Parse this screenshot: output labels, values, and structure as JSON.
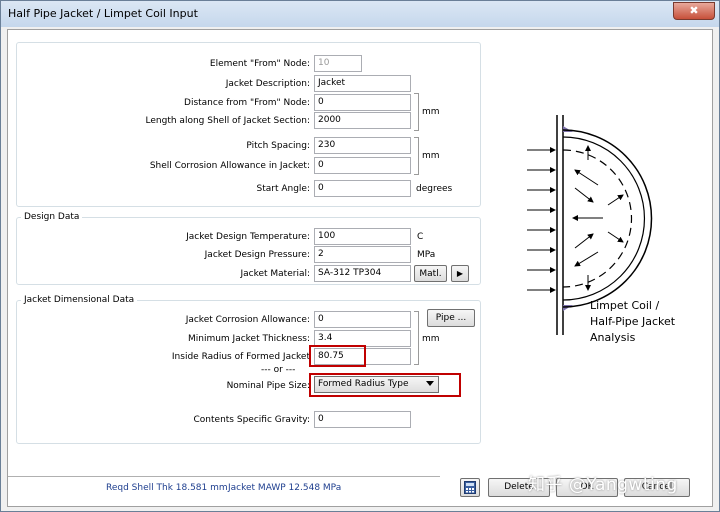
{
  "window": {
    "title": "Half Pipe Jacket / Limpet Coil Input",
    "close_glyph": "✖"
  },
  "top_group": {
    "fields": [
      {
        "label": "Element \"From\" Node:",
        "value": "10"
      },
      {
        "label": "Jacket Description:",
        "value": "Jacket"
      },
      {
        "label": "Distance from \"From\" Node:",
        "value": "0"
      },
      {
        "label": "Length along Shell of Jacket Section:",
        "value": "2000"
      },
      {
        "label": "Pitch Spacing:",
        "value": "230"
      },
      {
        "label": "Shell Corrosion Allowance in Jacket:",
        "value": "0"
      },
      {
        "label": "Start Angle:",
        "value": "0"
      }
    ],
    "unit_mm_1": "mm",
    "unit_mm_2": "mm",
    "unit_degrees": "degrees"
  },
  "design_group": {
    "title": "Design Data",
    "fields": [
      {
        "label": "Jacket Design Temperature:",
        "value": "100",
        "unit": "C"
      },
      {
        "label": "Jacket Design Pressure:",
        "value": "2",
        "unit": "MPa"
      },
      {
        "label": "Jacket Material:",
        "value": "SA-312 TP304"
      }
    ],
    "matl_button": "Matl.",
    "arrow_button": "▶"
  },
  "dim_group": {
    "title": "Jacket Dimensional Data",
    "fields": [
      {
        "label": "Jacket Corrosion Allowance:",
        "value": "0"
      },
      {
        "label": "Minimum Jacket Thickness:",
        "value": "3.4"
      },
      {
        "label": "Inside Radius of Formed  Jacket",
        "value": "80.75"
      }
    ],
    "unit_mm": "mm",
    "pipe_button": "Pipe ...",
    "or_text": "--- or ---",
    "nominal_label": "Nominal Pipe Size:",
    "nominal_value": "Formed Radius Type",
    "gravity_label": "Contents Specific Gravity:",
    "gravity_value": "0"
  },
  "diagram": {
    "caption_1": "Limpet Coil /",
    "caption_2": "Half-Pipe Jacket",
    "caption_3": "Analysis"
  },
  "status": {
    "shell_thk": "Reqd Shell Thk 18.581 mm",
    "mawp": "Jacket MAWP 12.548 MPa"
  },
  "buttons": {
    "delete": "Delete",
    "ok": "OK",
    "cancel": "Cancel"
  },
  "watermark": "知乎 @Yangwting",
  "colors": {
    "highlight": "#c00000",
    "status_text": "#1f3f8f"
  }
}
